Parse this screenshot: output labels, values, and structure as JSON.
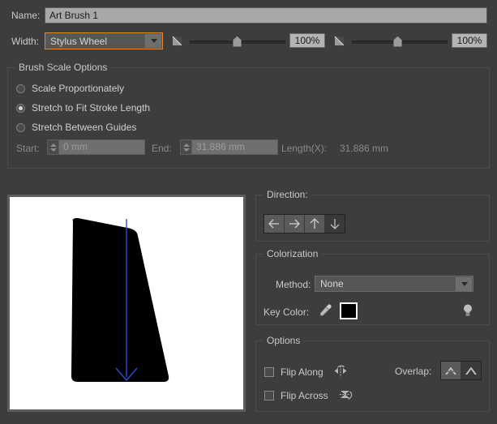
{
  "dialog": {
    "name_label": "Name:",
    "name_value": "Art Brush 1",
    "width_label": "Width:",
    "width_option": "Stylus Wheel",
    "width_slider_1_value": "100%",
    "width_slider_2_value": "100%"
  },
  "brush_scale": {
    "title": "Brush Scale Options",
    "options": [
      {
        "label": "Scale Proportionately",
        "selected": false
      },
      {
        "label": "Stretch to Fit Stroke Length",
        "selected": true
      },
      {
        "label": "Stretch Between Guides",
        "selected": false
      }
    ],
    "start_label": "Start:",
    "start_value": "0 mm",
    "end_label": "End:",
    "end_value": "31.886 mm",
    "length_label": "Length(X):",
    "length_value": "31.886 mm"
  },
  "direction": {
    "title": "Direction:",
    "buttons": [
      {
        "name": "direction-left",
        "glyph": "←",
        "selected": false
      },
      {
        "name": "direction-right",
        "glyph": "→",
        "selected": false
      },
      {
        "name": "direction-up",
        "glyph": "↑",
        "selected": false
      },
      {
        "name": "direction-down",
        "glyph": "↓",
        "selected": true
      }
    ]
  },
  "colorization": {
    "title": "Colorization",
    "method_label": "Method:",
    "method_value": "None",
    "key_color_label": "Key Color:",
    "key_color_hex": "#000000",
    "eyedropper_icon": "eyedropper-icon",
    "tip_icon": "lightbulb-icon"
  },
  "options": {
    "title": "Options",
    "flip_along_label": "Flip Along",
    "flip_along_checked": false,
    "flip_across_label": "Flip Across",
    "flip_across_checked": false,
    "overlap_label": "Overlap:",
    "overlap_buttons": [
      {
        "name": "overlap-prevent",
        "selected": false
      },
      {
        "name": "overlap-allow",
        "selected": true
      }
    ]
  },
  "preview": {
    "stroke_direction_color": "#2b4fd8",
    "shape_color": "#000000"
  },
  "colors": {
    "panel_bg": "#3d3d3d",
    "focus_accent": "#e08a29",
    "text": "#c9c9c9",
    "text_dim": "#8a8a8a"
  }
}
